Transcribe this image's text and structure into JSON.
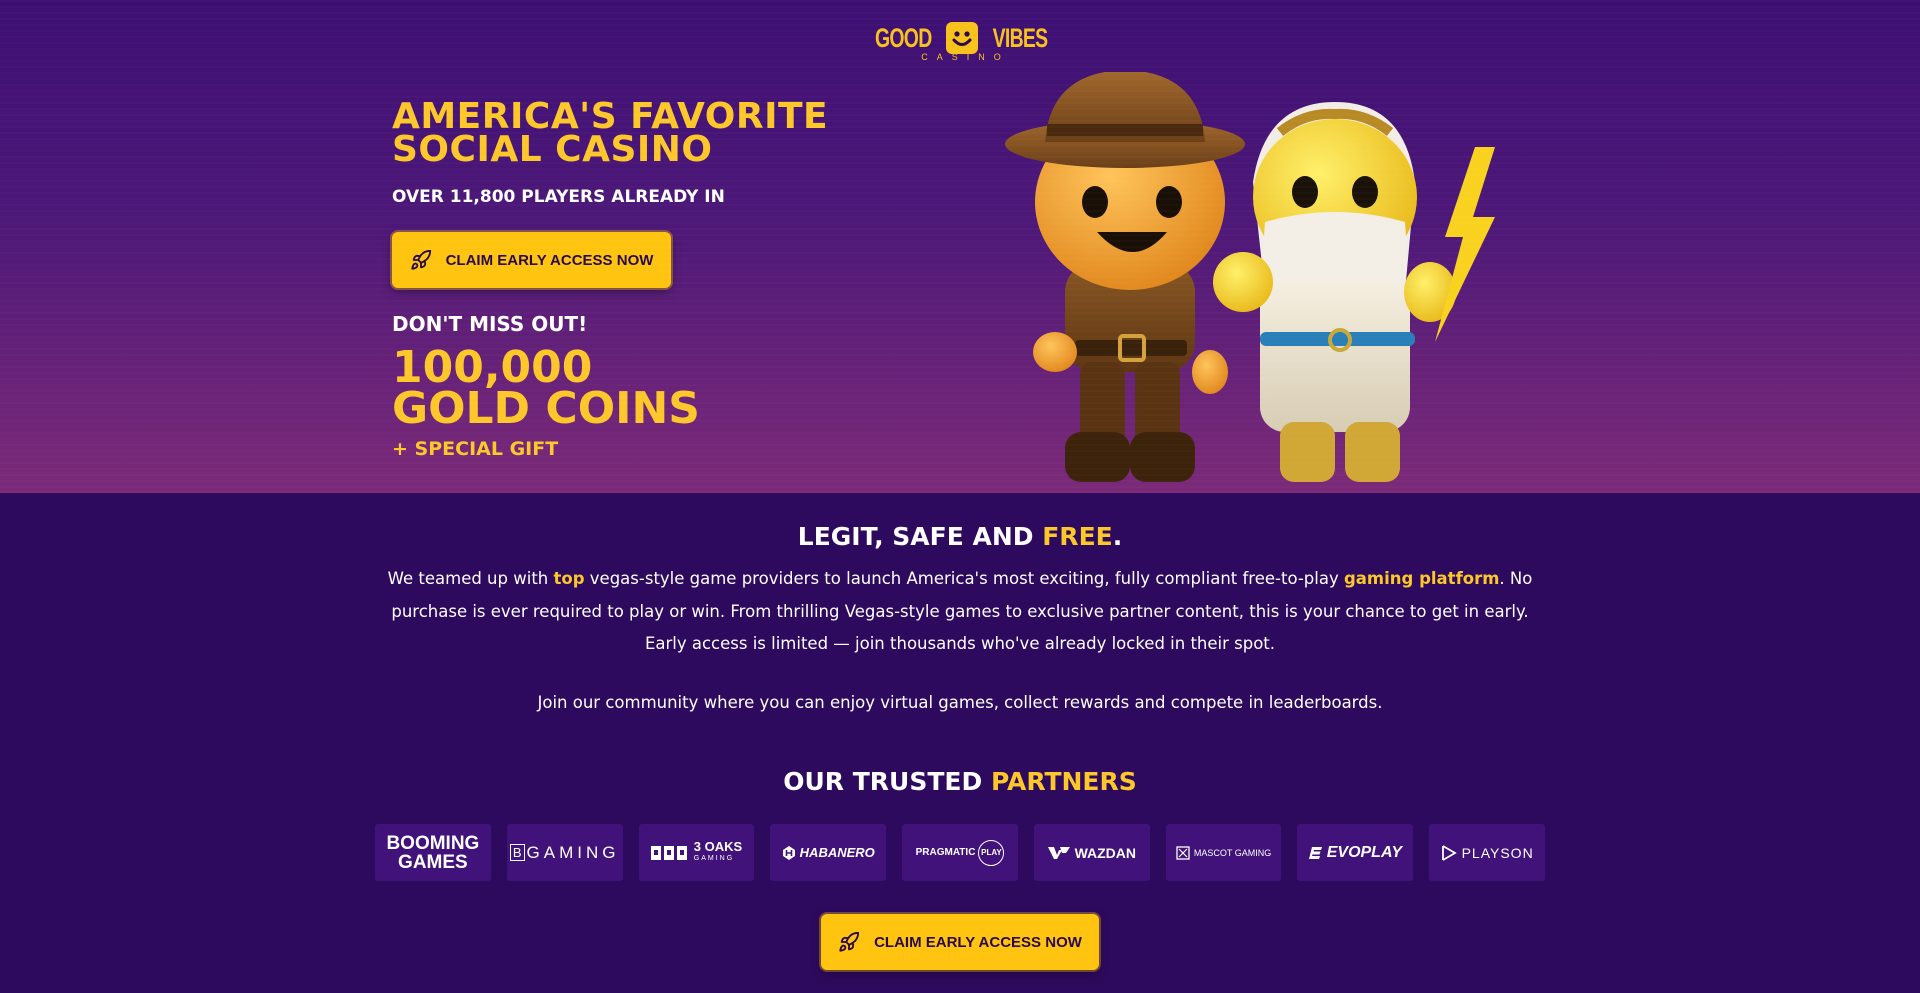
{
  "logo": {
    "left_word": "GOOD",
    "right_word": "VIBES",
    "sub": "CASINO"
  },
  "hero": {
    "headline_line1": "AMERICA'S FAVORITE",
    "headline_line2": "SOCIAL CASINO",
    "players": "OVER 11,800 PLAYERS ALREADY IN",
    "cta_label": "CLAIM EARLY ACCESS NOW",
    "dont_miss": "DON'T MISS OUT!",
    "coins_line1": "100,000",
    "coins_line2": "GOLD COINS",
    "gift": "+ SPECIAL GIFT"
  },
  "legit": {
    "title_prefix": "LEGIT, SAFE AND ",
    "title_highlight": "FREE",
    "title_suffix": ".",
    "desc_part1": "We teamed up with ",
    "desc_hl1": "top",
    "desc_part2": " vegas-style game providers to launch America's most exciting, fully compliant free-to-play ",
    "desc_hl2": "gaming platform",
    "desc_part3": ". No purchase is ever required to play or win. From thrilling Vegas-style games to exclusive partner content, this is your chance to get in early. Early access is limited — join thousands who've already locked in their spot.",
    "community": "Join our community where you can enjoy virtual games, collect rewards and compete in leaderboards."
  },
  "partners": {
    "title_prefix": "OUR TRUSTED ",
    "title_highlight": "PARTNERS",
    "items": [
      {
        "line1": "BOOMING",
        "line2": "GAMES"
      },
      {
        "name": "GAMING",
        "badge": "B"
      },
      {
        "name": "3 OAKS",
        "sub": "GAMING"
      },
      {
        "name": "HABANERO"
      },
      {
        "name": "PRAGMATIC",
        "badge": "PLAY"
      },
      {
        "name": "WAZDAN"
      },
      {
        "name": "MASCOT GAMING"
      },
      {
        "name": "EVOPLAY"
      },
      {
        "name": "PLAYSON"
      }
    ]
  },
  "bottom_cta": {
    "label": "CLAIM EARLY ACCESS NOW"
  },
  "colors": {
    "accent": "#fcc72a",
    "button": "#fec40f",
    "bg_top": "#3d0f73",
    "bg_section": "#2e0a5e",
    "partner_bg": "#40127a"
  }
}
